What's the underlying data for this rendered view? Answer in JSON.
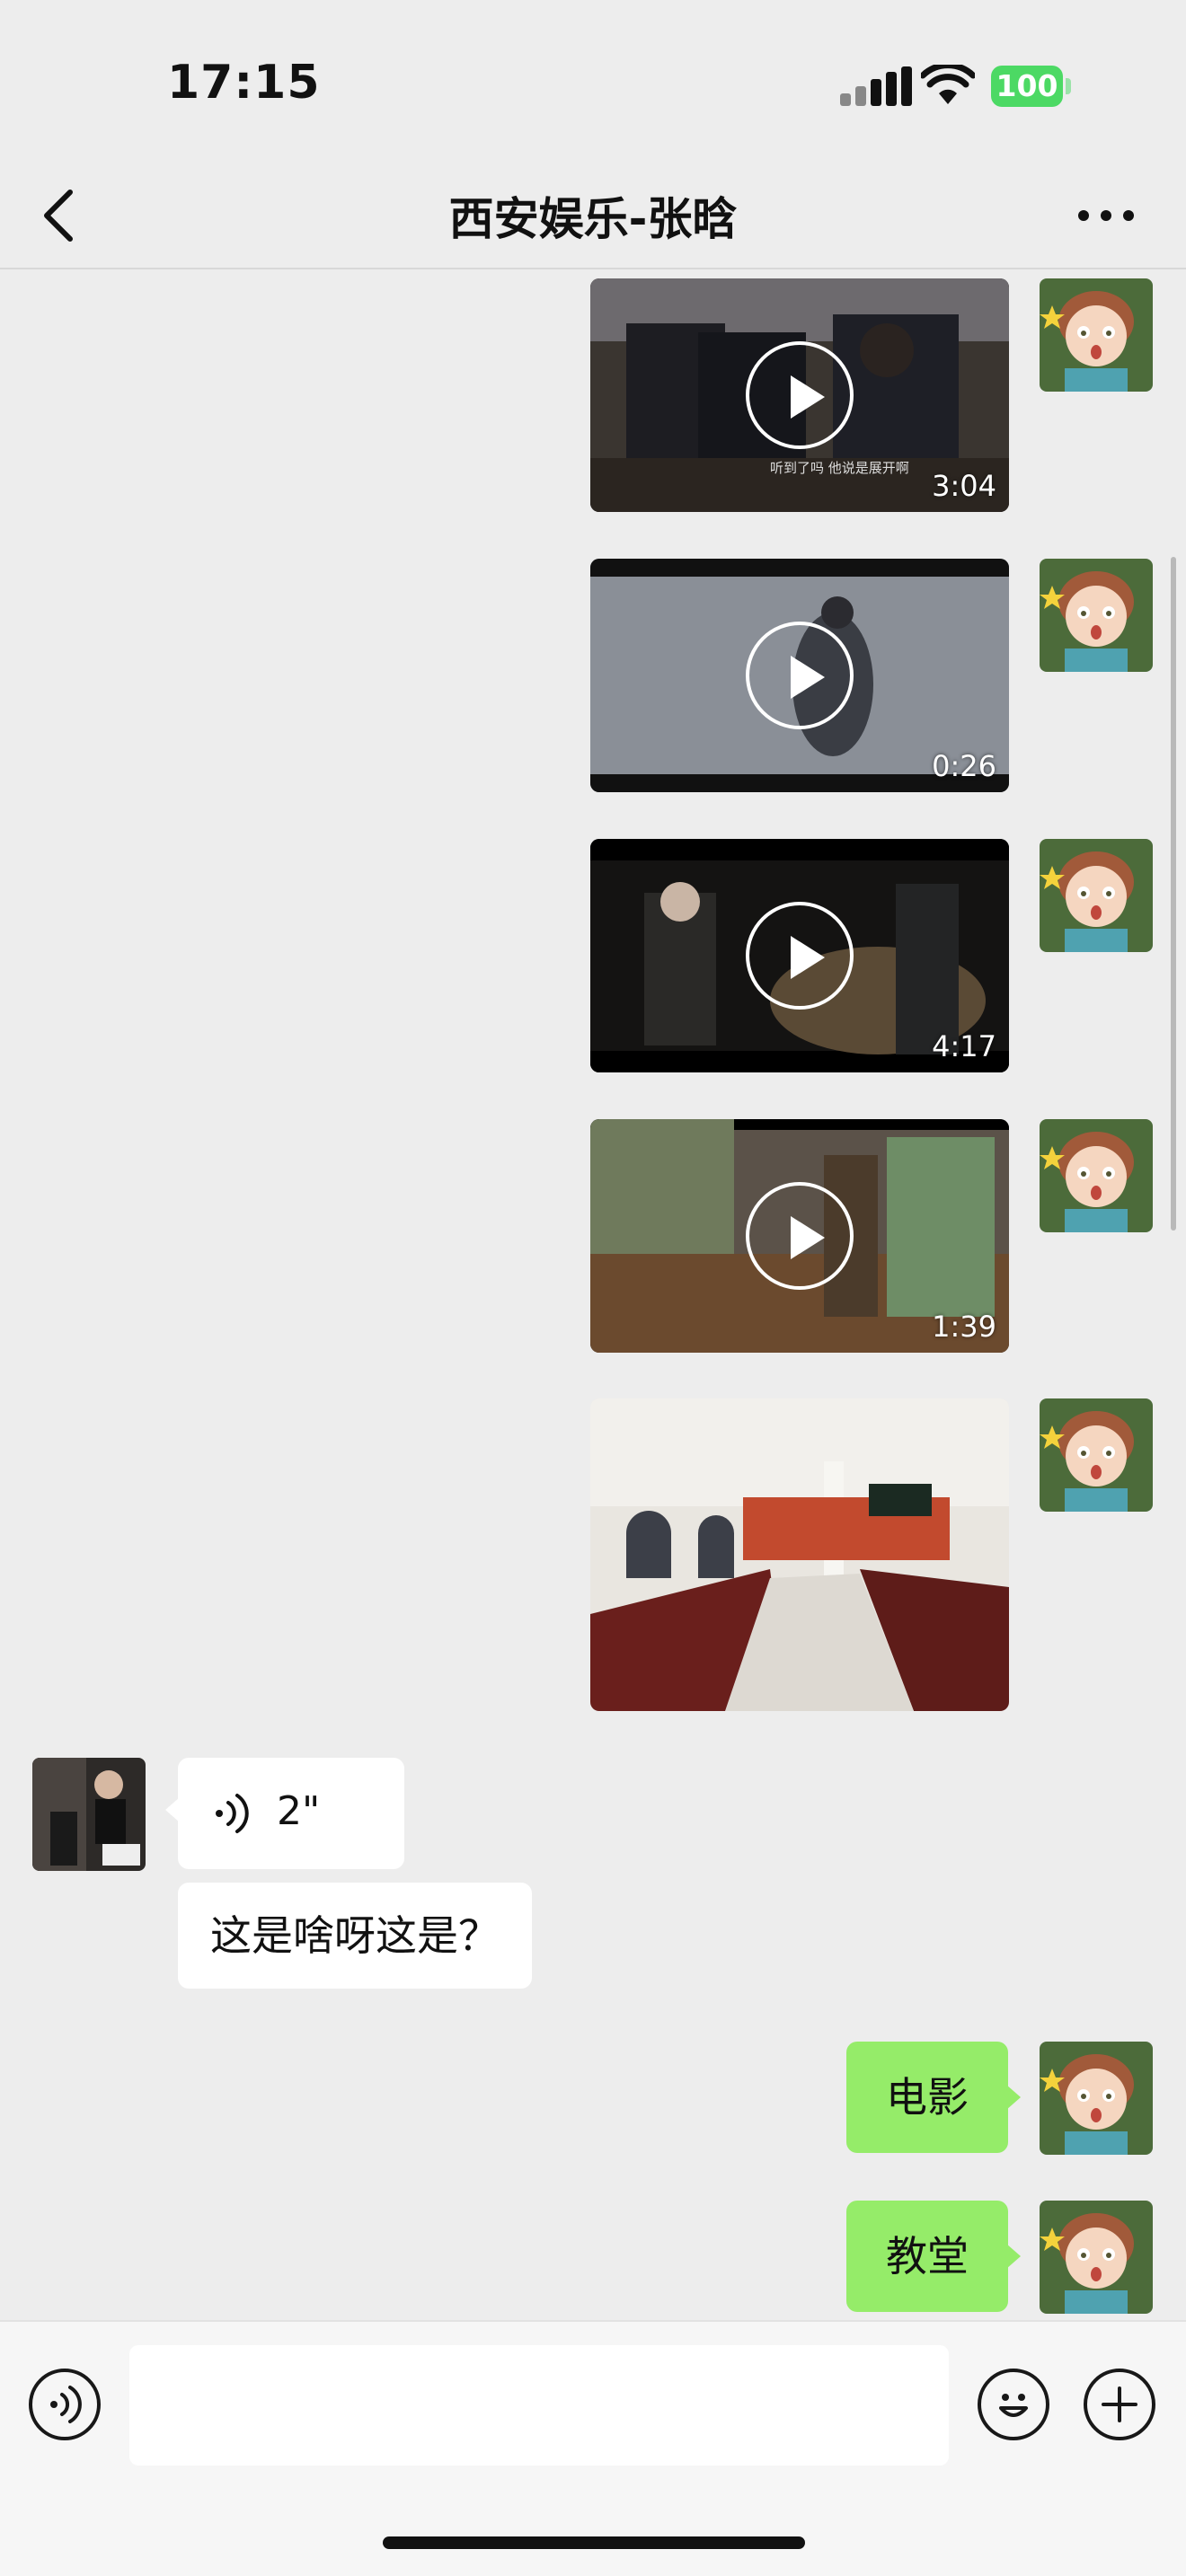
{
  "status_bar": {
    "time": "17:15",
    "battery": "100"
  },
  "header": {
    "title": "西安娱乐-张晗"
  },
  "messages": {
    "videos": [
      {
        "duration": "3:04",
        "caption": "听到了吗 他说是展开啊"
      },
      {
        "duration": "0:26"
      },
      {
        "duration": "4:17"
      },
      {
        "duration": "1:39"
      }
    ],
    "voice": {
      "duration": "2\""
    },
    "incoming_text": "这是啥呀这是？",
    "outgoing": [
      "电影",
      "教堂"
    ]
  },
  "input": {
    "placeholder": ""
  },
  "colors": {
    "outgoing_bubble": "#95ec69",
    "background": "#ededed",
    "battery": "#4cd964"
  }
}
